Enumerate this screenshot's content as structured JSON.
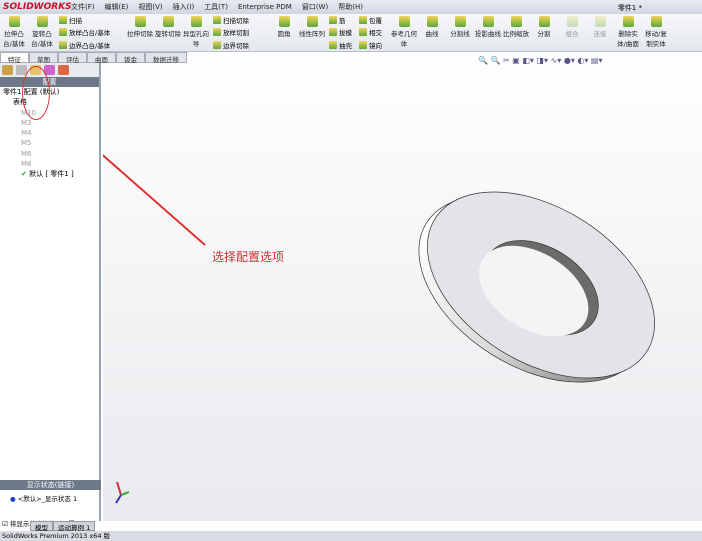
{
  "app": {
    "logo": "SOLIDWORKS",
    "doc_title": "零件1 *"
  },
  "menu": [
    "文件(F)",
    "编辑(E)",
    "视图(V)",
    "插入(I)",
    "工具(T)",
    "Enterprise PDM",
    "窗口(W)",
    "帮助(H)"
  ],
  "ribbon": {
    "big1": [
      "拉伸凸台/基体",
      "旋转凸台/基体"
    ],
    "small1": [
      "扫描",
      "放样凸台/基体",
      "边界凸台/基体"
    ],
    "big2": [
      "拉伸切除",
      "旋转切除",
      "异型孔向导"
    ],
    "small2": [
      "扫描切除",
      "放样切割",
      "边界切除"
    ],
    "big3": [
      "圆角",
      "线性阵列"
    ],
    "small3": [
      "筋",
      "拔模",
      "抽壳"
    ],
    "small4": [
      "包覆",
      "相交",
      "镜向"
    ],
    "big4": [
      "参考几何体",
      "曲线",
      "分割线",
      "投影曲线",
      "比例缩放",
      "分割",
      "组合",
      "连接",
      "删除实体/曲面",
      "移动/复制实体"
    ]
  },
  "tabs": [
    "特征",
    "草图",
    "评估",
    "曲面",
    "钣金",
    "数据迁移"
  ],
  "panel": {
    "header": "配置",
    "root": "零件1 配置 (默认)",
    "table": "表格",
    "configs": [
      "M10",
      "M3",
      "M4",
      "M5",
      "M6",
      "M8"
    ],
    "active_config": "默认 [ 零件1 ]",
    "display_header": "显示状态(链接)",
    "display_state": "<默认>_显示状态 1",
    "link_checkbox": "将显示状态连接到配置",
    "link_checked": true
  },
  "bottom_tabs": [
    "模型",
    "运动算例 1"
  ],
  "annotation": "选择配置选项",
  "status": "SolidWorks Premium 2013 x64 版"
}
